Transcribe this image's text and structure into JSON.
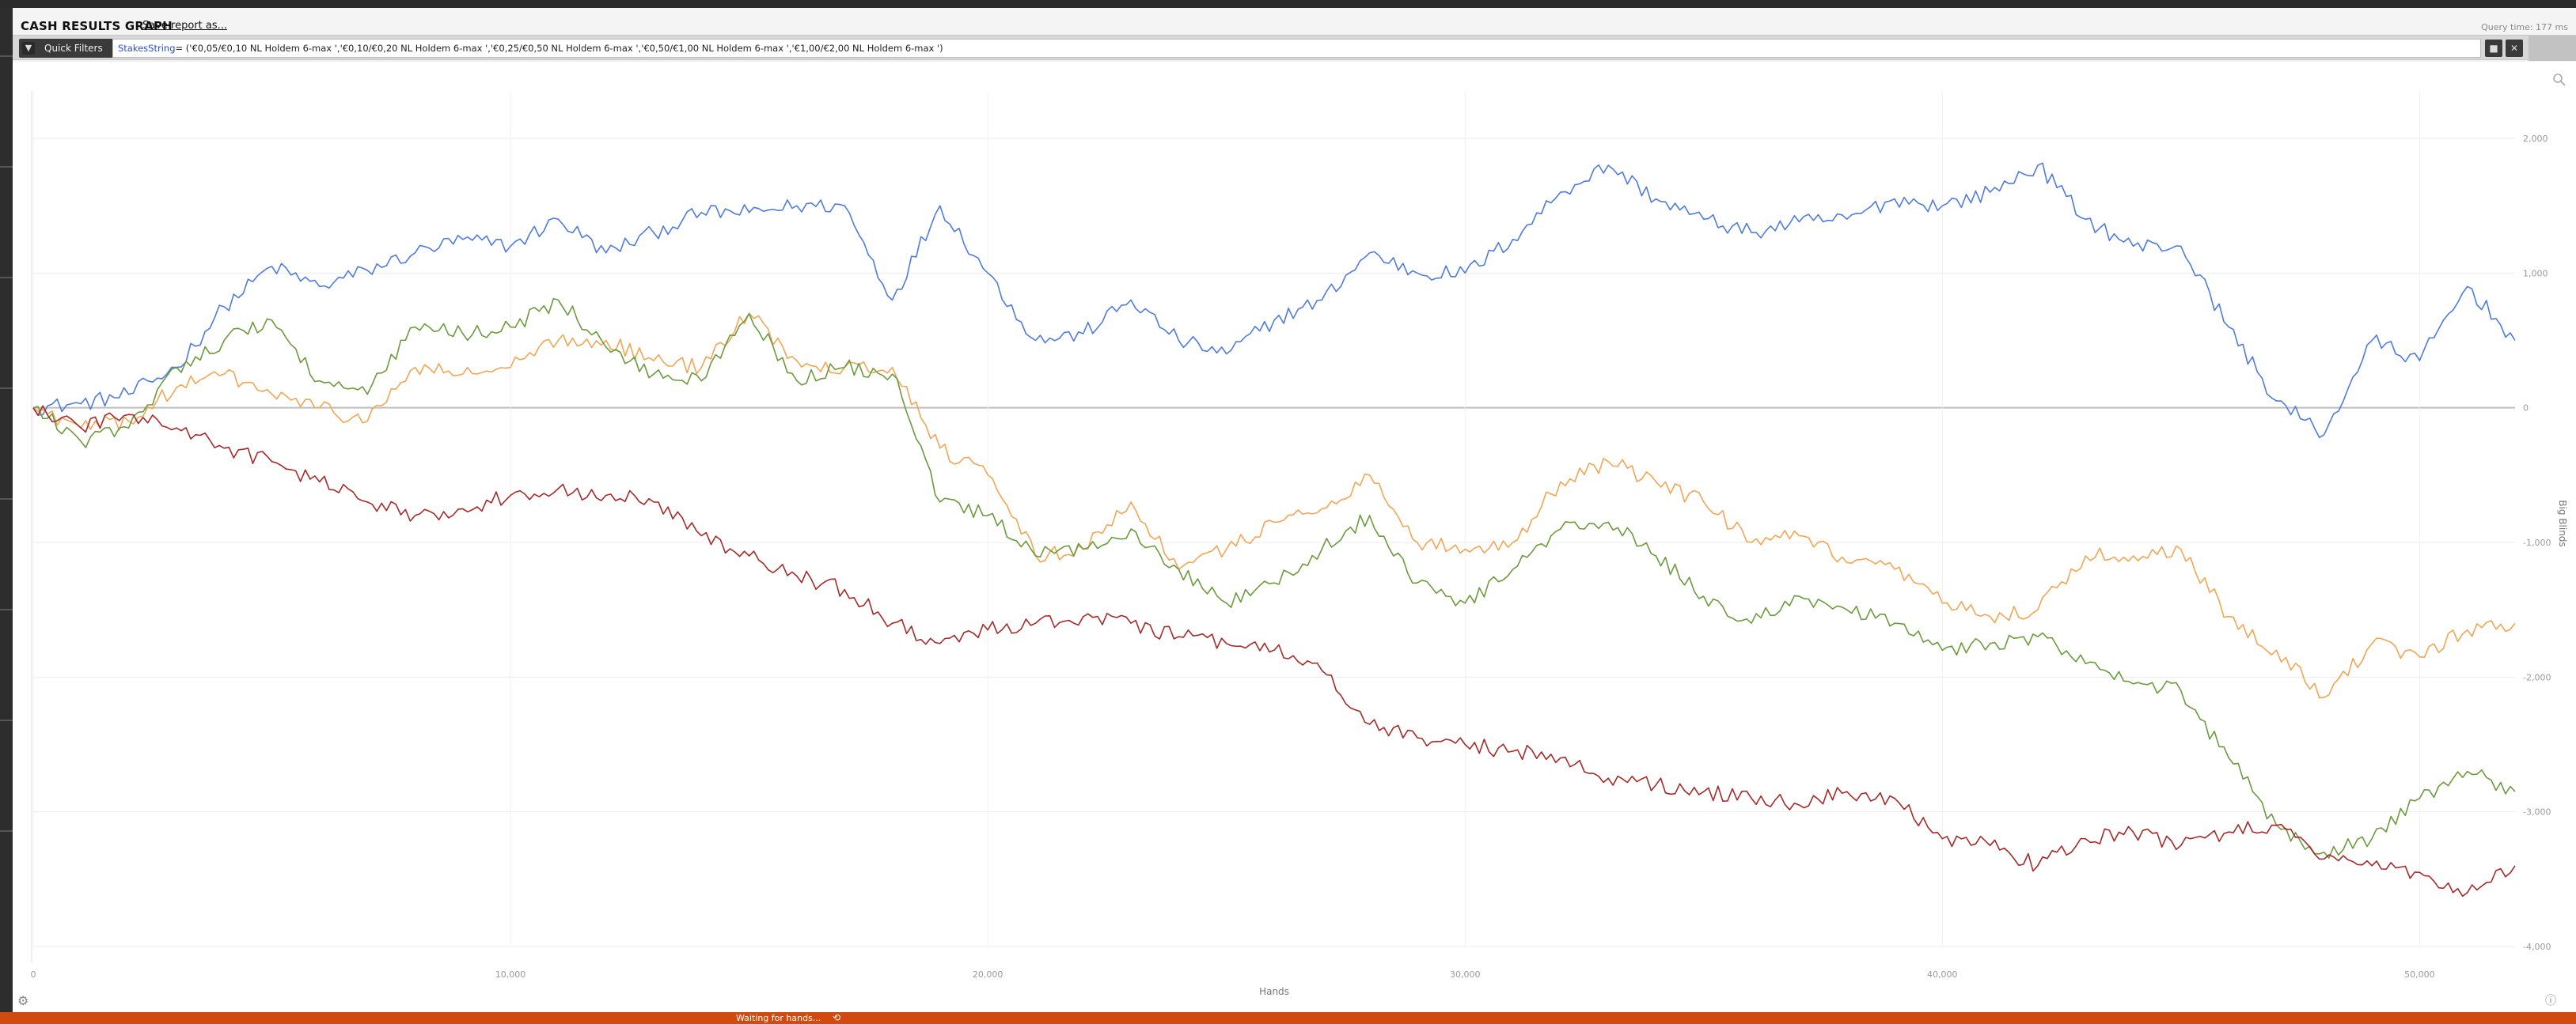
{
  "header": {
    "title": "CASH RESULTS GRAPH",
    "save_label": "Save report as...",
    "query_time": "Query time: 177 ms"
  },
  "filter_bar": {
    "label": "Quick Filters",
    "icon": "filter-icon",
    "expression_key": "StakesString",
    "expression_value": "= ('€0,05/€0,10 NL Holdem 6-max ','€0,10/€0,20 NL Holdem 6-max ','€0,25/€0,50 NL Holdem 6-max ','€0,50/€1,00 NL Holdem 6-max ','€1,00/€2,00 NL Holdem 6-max ')",
    "buttons": [
      "save-filter-icon",
      "clear-filter-icon"
    ]
  },
  "status": {
    "text": "Waiting for hands...",
    "icon": "refresh-icon"
  },
  "chart_data": {
    "type": "line",
    "xlabel": "Hands",
    "ylabel": "Big Blinds",
    "xlim": [
      0,
      52000
    ],
    "ylim": [
      -4000,
      2000
    ],
    "x_ticks": [
      0,
      10000,
      20000,
      30000,
      40000,
      50000
    ],
    "x_tick_labels": [
      "0",
      "10,000",
      "20,000",
      "30,000",
      "40,000",
      "50,000"
    ],
    "y_ticks": [
      2000,
      1000,
      0,
      -1000,
      -2000,
      -3000,
      -4000
    ],
    "y_tick_labels": [
      "2,000",
      "1,000",
      "0",
      "-1,000",
      "-2,000",
      "-3,000",
      "-4,000"
    ],
    "grid": true,
    "series": [
      {
        "color": "#4f7be0",
        "x": [
          0,
          1000,
          2000,
          3000,
          4000,
          5000,
          6000,
          7000,
          8000,
          9000,
          10000,
          11000,
          12000,
          13000,
          14000,
          15000,
          16000,
          17000,
          18000,
          19000,
          20000,
          21000,
          22000,
          23000,
          24000,
          25000,
          26000,
          27000,
          28000,
          29000,
          30000,
          31000,
          32000,
          33000,
          34000,
          35000,
          36000,
          37000,
          38000,
          39000,
          40000,
          41000,
          42000,
          43000,
          44000,
          45000,
          46000,
          47000,
          48000,
          49000,
          50000,
          51000,
          52000
        ],
        "y": [
          0,
          30,
          100,
          300,
          750,
          1050,
          900,
          1020,
          1150,
          1250,
          1200,
          1400,
          1150,
          1300,
          1450,
          1450,
          1500,
          1500,
          800,
          1500,
          1000,
          500,
          550,
          800,
          500,
          400,
          650,
          800,
          1150,
          1000,
          1000,
          1250,
          1600,
          1800,
          1550,
          1400,
          1300,
          1380,
          1400,
          1550,
          1500,
          1600,
          1800,
          1400,
          1200,
          1200,
          600,
          50,
          -200,
          500,
          350,
          900,
          500
        ]
      },
      {
        "color": "#f4a554",
        "x": [
          0,
          1000,
          2000,
          3000,
          4000,
          5000,
          6000,
          7000,
          8000,
          9000,
          10000,
          11000,
          12000,
          13000,
          14000,
          15000,
          16000,
          17000,
          18000,
          19000,
          20000,
          21000,
          22000,
          23000,
          24000,
          25000,
          26000,
          27000,
          28000,
          29000,
          30000,
          31000,
          32000,
          33000,
          34000,
          35000,
          36000,
          37000,
          38000,
          39000,
          40000,
          41000,
          42000,
          43000,
          44000,
          45000,
          46000,
          47000,
          48000,
          49000,
          50000,
          51000,
          52000
        ],
        "y": [
          0,
          -150,
          -100,
          150,
          250,
          100,
          0,
          -100,
          300,
          250,
          300,
          500,
          500,
          350,
          300,
          700,
          350,
          300,
          300,
          -300,
          -500,
          -1100,
          -1050,
          -700,
          -1200,
          -1050,
          -850,
          -750,
          -500,
          -1000,
          -1050,
          -1000,
          -550,
          -400,
          -550,
          -700,
          -1000,
          -950,
          -1150,
          -1200,
          -1450,
          -1550,
          -1500,
          -1100,
          -1100,
          -1050,
          -1550,
          -1800,
          -2150,
          -1750,
          -1850,
          -1650,
          -1600
        ]
      },
      {
        "color": "#6c9a3e",
        "x": [
          0,
          1000,
          2000,
          3000,
          4000,
          5000,
          6000,
          7000,
          8000,
          9000,
          10000,
          11000,
          12000,
          13000,
          14000,
          15000,
          16000,
          17000,
          18000,
          19000,
          20000,
          21000,
          22000,
          23000,
          24000,
          25000,
          26000,
          27000,
          28000,
          29000,
          30000,
          31000,
          32000,
          33000,
          34000,
          35000,
          36000,
          37000,
          38000,
          39000,
          40000,
          41000,
          42000,
          43000,
          44000,
          45000,
          46000,
          47000,
          48000,
          49000,
          50000,
          51000,
          52000
        ],
        "y": [
          0,
          -250,
          -150,
          300,
          500,
          650,
          200,
          100,
          600,
          550,
          600,
          800,
          450,
          250,
          200,
          700,
          200,
          300,
          250,
          -700,
          -800,
          -1100,
          -1050,
          -900,
          -1200,
          -1450,
          -1300,
          -1050,
          -800,
          -1300,
          -1450,
          -1200,
          -900,
          -850,
          -1100,
          -1400,
          -1600,
          -1400,
          -1500,
          -1600,
          -1800,
          -1750,
          -1700,
          -1900,
          -2050,
          -2100,
          -2600,
          -3100,
          -3300,
          -3200,
          -2900,
          -2700,
          -2850
        ]
      },
      {
        "color": "#a52a2a",
        "x": [
          0,
          1000,
          2000,
          3000,
          4000,
          5000,
          6000,
          7000,
          8000,
          9000,
          10000,
          11000,
          12000,
          13000,
          14000,
          15000,
          16000,
          17000,
          18000,
          19000,
          20000,
          21000,
          22000,
          23000,
          24000,
          25000,
          26000,
          27000,
          28000,
          29000,
          30000,
          31000,
          32000,
          33000,
          34000,
          35000,
          36000,
          37000,
          38000,
          39000,
          40000,
          41000,
          42000,
          43000,
          44000,
          45000,
          46000,
          47000,
          48000,
          49000,
          50000,
          51000,
          52000
        ],
        "y": [
          0,
          -150,
          -50,
          -150,
          -300,
          -400,
          -550,
          -700,
          -800,
          -750,
          -650,
          -600,
          -650,
          -700,
          -950,
          -1100,
          -1250,
          -1350,
          -1600,
          -1750,
          -1650,
          -1600,
          -1550,
          -1600,
          -1700,
          -1750,
          -1800,
          -1950,
          -2350,
          -2450,
          -2500,
          -2550,
          -2600,
          -2750,
          -2800,
          -2850,
          -2900,
          -2950,
          -2850,
          -2900,
          -3200,
          -3250,
          -3400,
          -3200,
          -3150,
          -3250,
          -3150,
          -3100,
          -3350,
          -3400,
          -3450,
          -3600,
          -3400
        ]
      }
    ]
  }
}
